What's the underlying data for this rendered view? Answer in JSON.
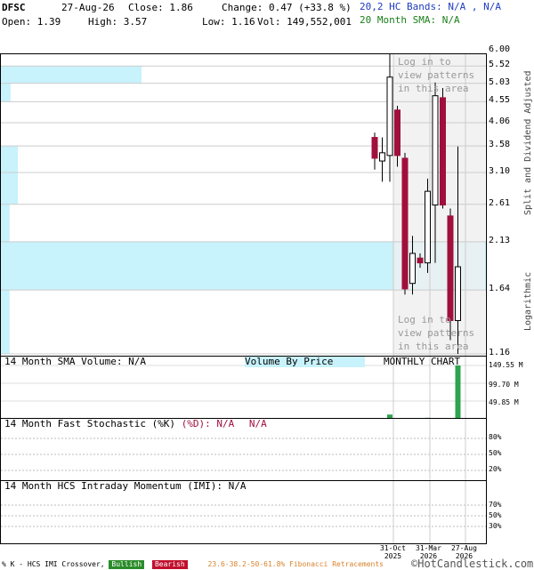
{
  "header": {
    "symbol": "DFSC",
    "date": "27-Aug-26",
    "close": "Close: 1.86",
    "change": "Change: 0.47 (+33.8 %)",
    "open": "Open: 1.39",
    "high": "High: 3.57",
    "low": "Low: 1.16",
    "vol": "Vol: 149,552,001",
    "hc_bands": "20,2 HC Bands: N/A , N/A",
    "sma20": "20 Month SMA: N/A"
  },
  "price_panel": {
    "right_label_top": "Split and Dividend Adjusted",
    "right_label_bottom": "Logarithmic",
    "login_text_top": [
      "Log in to",
      "view patterns",
      "in this area"
    ],
    "login_text_bottom": [
      "Log in to",
      "view patterns",
      "in this area"
    ]
  },
  "volume_panel": {
    "label": "14 Month SMA Volume: N/A",
    "vbp_label": "Volume By Price",
    "chart_label": "MONTHLY CHART",
    "ticks": [
      "149.55 M",
      "99.70 M",
      "49.85 M"
    ]
  },
  "stoch_panel": {
    "label": "14 Month Fast Stochastic (%K)",
    "label_d": "(%D): N/A",
    "label_na": "N/A",
    "ticks": [
      "80%",
      "50%",
      "20%"
    ]
  },
  "imi_panel": {
    "label": "14 Month HCS Intraday Momentum (IMI): N/A",
    "ticks": [
      "70%",
      "50%",
      "30%"
    ]
  },
  "x_axis": {
    "labels": [
      {
        "month": "31-Oct",
        "year": "2025"
      },
      {
        "month": "31-Mar",
        "year": "2026"
      },
      {
        "month": "27-Aug",
        "year": "2026"
      }
    ]
  },
  "footer": {
    "crossover": "% K - HCS IMI Crossover,",
    "bullish": "Bullish",
    "bearish": "Bearish",
    "fib": "23.6-38.2-50-61.8% Fibonacci Retracements",
    "brand": "©HotCandlestick.com"
  },
  "colors": {
    "up_candle": "#ffffff",
    "down_candle": "#a0103c",
    "vbp": "#c8f2fc",
    "volume_bar": "#2ea44f",
    "grid": "#cccccc",
    "pattern_box": "#efefef",
    "bullish": "#2a8c2a",
    "bearish": "#c0102c",
    "fib": "#d9822b"
  },
  "chart_data": {
    "type": "candlestick",
    "scale": "log",
    "ylim": [
      1.16,
      6.0
    ],
    "y_ticks": [
      6.0,
      5.52,
      5.03,
      4.55,
      4.06,
      3.58,
      3.1,
      2.61,
      2.13,
      1.64,
      1.16
    ],
    "candles": [
      {
        "open": 3.75,
        "high": 3.85,
        "low": 3.15,
        "close": 3.35
      },
      {
        "open": 3.3,
        "high": 3.75,
        "low": 2.95,
        "close": 3.45
      },
      {
        "open": 3.4,
        "high": 6.0,
        "low": 2.95,
        "close": 5.2
      },
      {
        "open": 4.35,
        "high": 4.45,
        "low": 3.2,
        "close": 3.4
      },
      {
        "open": 3.35,
        "high": 3.45,
        "low": 1.6,
        "close": 1.65
      },
      {
        "open": 1.7,
        "high": 2.2,
        "low": 1.6,
        "close": 2.0
      },
      {
        "open": 1.95,
        "high": 2.0,
        "low": 1.85,
        "close": 1.9
      },
      {
        "open": 1.9,
        "high": 3.0,
        "low": 1.8,
        "close": 2.8
      },
      {
        "open": 2.6,
        "high": 5.05,
        "low": 1.9,
        "close": 4.7
      },
      {
        "open": 4.65,
        "high": 4.9,
        "low": 2.55,
        "close": 2.6
      },
      {
        "open": 2.45,
        "high": 2.55,
        "low": 1.25,
        "close": 1.39
      },
      {
        "open": 1.39,
        "high": 3.57,
        "low": 1.16,
        "close": 1.86
      }
    ],
    "volume": [
      2,
      1,
      12,
      2,
      2,
      2,
      2,
      3,
      2,
      2,
      2,
      149.55
    ],
    "volume_ylim": [
      0,
      149.55
    ],
    "volume_by_price": [
      {
        "low": 5.03,
        "high": 5.52,
        "length": 0.29
      },
      {
        "low": 4.55,
        "high": 5.03,
        "length": 0.02
      },
      {
        "low": 3.1,
        "high": 3.58,
        "length": 0.035
      },
      {
        "low": 2.61,
        "high": 3.1,
        "length": 0.035
      },
      {
        "low": 2.13,
        "high": 2.61,
        "length": 0.018
      },
      {
        "low": 1.64,
        "high": 2.13,
        "length": 1.0
      },
      {
        "low": 1.16,
        "high": 1.64,
        "length": 0.018
      }
    ]
  }
}
